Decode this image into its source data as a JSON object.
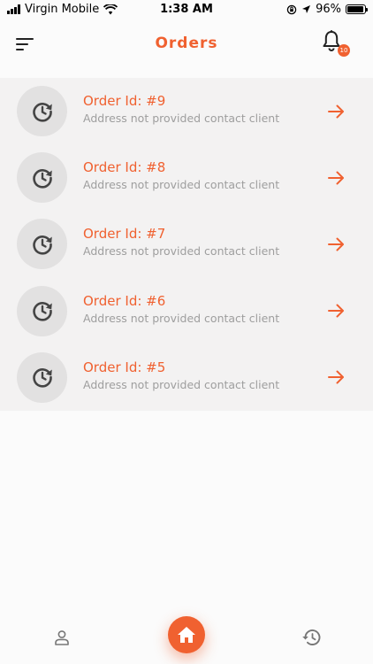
{
  "status_bar": {
    "carrier": "Virgin Mobile",
    "time": "1:38 AM",
    "battery": "96%",
    "battery_level": 0.96
  },
  "header": {
    "title": "Orders",
    "notification_count": "10"
  },
  "orders": [
    {
      "title": "Order Id: #9",
      "subtitle": "Address not provided contact client"
    },
    {
      "title": "Order Id: #8",
      "subtitle": "Address not provided contact client"
    },
    {
      "title": "Order Id: #7",
      "subtitle": "Address not provided contact client"
    },
    {
      "title": "Order Id: #6",
      "subtitle": "Address not provided contact client"
    },
    {
      "title": "Order Id: #5",
      "subtitle": "Address not provided contact client"
    }
  ],
  "icons": {
    "menu": "menu-icon",
    "notifications": "bell-icon",
    "order": "clock-history-icon",
    "open": "arrow-right-icon",
    "nav_profile": "person-icon",
    "nav_home": "home-icon",
    "nav_history": "history-icon"
  },
  "colors": {
    "accent": "#f06130",
    "subtitle": "#9e9e9e",
    "list_background": "#f3f2f2",
    "avatar_background": "#e2e1e1"
  }
}
